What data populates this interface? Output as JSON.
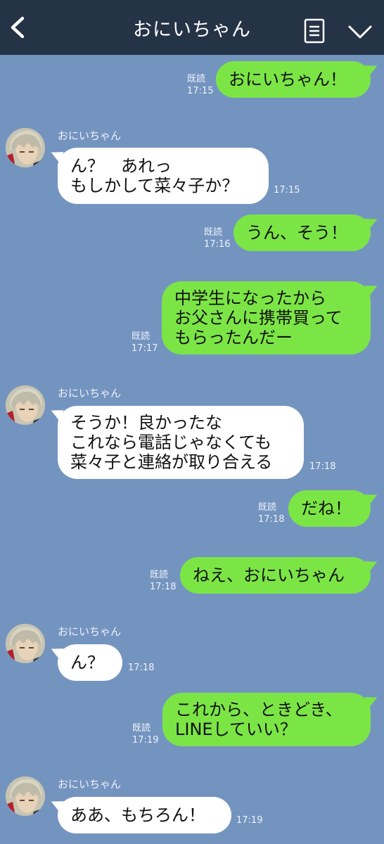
{
  "header": {
    "title": "おにいちゃん",
    "icons": [
      "back-chevron-icon",
      "menu-icon",
      "chevron-down-icon"
    ]
  },
  "colors": {
    "chat_background": "#7494c0",
    "header": "#253347",
    "my_bubble": "#7ce546",
    "their_bubble": "#ffffff"
  },
  "messages": [
    {
      "from": "me",
      "lines": [
        "おにいちゃん！"
      ],
      "read": "既読",
      "time": "17:15"
    },
    {
      "from": "them",
      "sender": "おにいちゃん",
      "lines": [
        "ん？　あれっ",
        "もしかして菜々子か？"
      ],
      "time": "17:15"
    },
    {
      "from": "me",
      "lines": [
        "うん、そう！"
      ],
      "read": "既読",
      "time": "17:16"
    },
    {
      "from": "me",
      "lines": [
        "中学生になったから",
        "お父さんに携帯買って",
        "もらったんだー"
      ],
      "read": "既読",
      "time": "17:17"
    },
    {
      "from": "them",
      "sender": "おにいちゃん",
      "lines": [
        "そうか！良かったな",
        "これなら電話じゃなくても",
        "菜々子と連絡が取り合える"
      ],
      "time": "17:18"
    },
    {
      "from": "me",
      "lines": [
        "だね！"
      ],
      "read": "既読",
      "time": "17:18"
    },
    {
      "from": "me",
      "lines": [
        "ねえ、おにいちゃん"
      ],
      "read": "既読",
      "time": "17:18"
    },
    {
      "from": "them",
      "sender": "おにいちゃん",
      "lines": [
        "ん？"
      ],
      "time": "17:18"
    },
    {
      "from": "me",
      "lines": [
        "これから、ときどき、",
        "LINEしていい？"
      ],
      "read": "既読",
      "time": "17:19"
    },
    {
      "from": "them",
      "sender": "おにいちゃん",
      "lines": [
        "ああ、もちろん！"
      ],
      "time": "17:19"
    }
  ]
}
